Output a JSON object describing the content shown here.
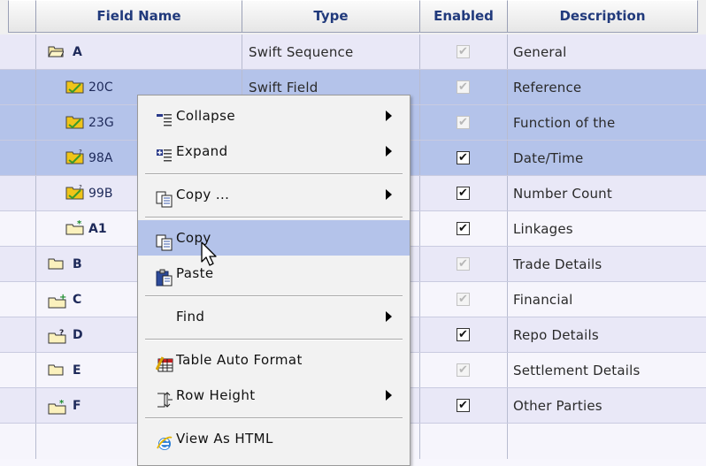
{
  "columns": {
    "name": "Field Name",
    "type": "Type",
    "enabled": "Enabled",
    "description": "Description"
  },
  "rows": [
    {
      "name": "A",
      "type": "Swift Sequence",
      "enabled": false,
      "description": "General",
      "icon": "open-folder-icon"
    },
    {
      "name": "20C",
      "type": "Swift Field",
      "enabled": false,
      "description": "Reference",
      "icon": "yellow-folder-icon"
    },
    {
      "name": "23G",
      "type": "",
      "enabled": false,
      "description": "Function of the",
      "icon": "yellow-folder-icon"
    },
    {
      "name": "98A",
      "type": "",
      "enabled": true,
      "description": "Date/Time",
      "icon": "yellow-folder-question-icon"
    },
    {
      "name": "99B",
      "type": "",
      "enabled": true,
      "description": "Number Count",
      "icon": "yellow-folder-question-icon"
    },
    {
      "name": "A1",
      "type": "",
      "enabled": true,
      "description": "Linkages",
      "icon": "new-folder-icon"
    },
    {
      "name": "B",
      "type": "",
      "enabled": false,
      "description": "Trade Details",
      "icon": "folder-icon"
    },
    {
      "name": "C",
      "type": "",
      "enabled": false,
      "description": "Financial",
      "icon": "add-folder-icon"
    },
    {
      "name": "D",
      "type": "",
      "enabled": true,
      "description": "Repo Details",
      "icon": "question-folder-icon"
    },
    {
      "name": "E",
      "type": "",
      "enabled": false,
      "description": "Settlement Details",
      "icon": "folder-icon"
    },
    {
      "name": "F",
      "type": "",
      "enabled": true,
      "description": "Other Parties",
      "icon": "new-folder-icon"
    }
  ],
  "menu": {
    "items": [
      {
        "label": "Collapse",
        "icon": "collapse-icon",
        "submenu": true
      },
      {
        "label": "Expand",
        "icon": "expand-icon",
        "submenu": true
      },
      {
        "label": "Copy ...",
        "icon": "copy-icon",
        "submenu": true
      },
      {
        "label": "Copy",
        "icon": "copy-icon",
        "submenu": false,
        "highlighted": true
      },
      {
        "label": "Paste",
        "icon": "paste-icon",
        "submenu": false
      },
      {
        "label": "Find",
        "icon": "",
        "submenu": true
      },
      {
        "label": "Table Auto Format",
        "icon": "table-format-icon",
        "submenu": false
      },
      {
        "label": "Row Height",
        "icon": "row-height-icon",
        "submenu": true
      },
      {
        "label": "View As HTML",
        "icon": "ie-browser-icon",
        "submenu": false
      }
    ]
  },
  "colors": {
    "header_text": "#213a7c",
    "selection": "#b4c3ea",
    "row_alt": "#e9e8f7",
    "row_plain": "#f6f5fc"
  }
}
